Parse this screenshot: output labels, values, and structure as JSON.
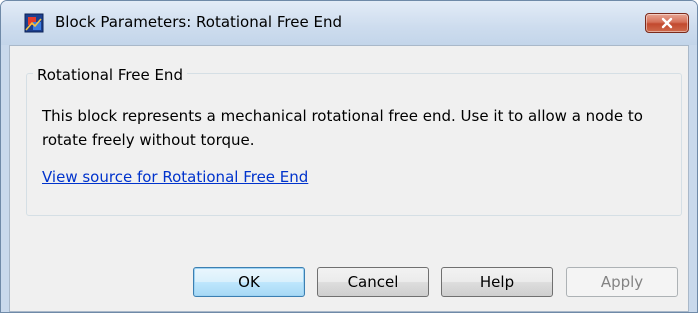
{
  "window": {
    "title": "Block Parameters: Rotational Free End",
    "app_icon": "simulink-block-icon",
    "close_icon": "close-icon"
  },
  "group": {
    "title": "Rotational Free End",
    "description": "This block represents a mechanical rotational free end. Use it to allow a node to rotate freely without torque.",
    "link_text": "View source for Rotational Free End"
  },
  "buttons": {
    "ok": "OK",
    "cancel": "Cancel",
    "help": "Help",
    "apply": "Apply"
  },
  "colors": {
    "link": "#0033cc",
    "close_button": "#c24a2f",
    "disabled_text": "#838383"
  }
}
